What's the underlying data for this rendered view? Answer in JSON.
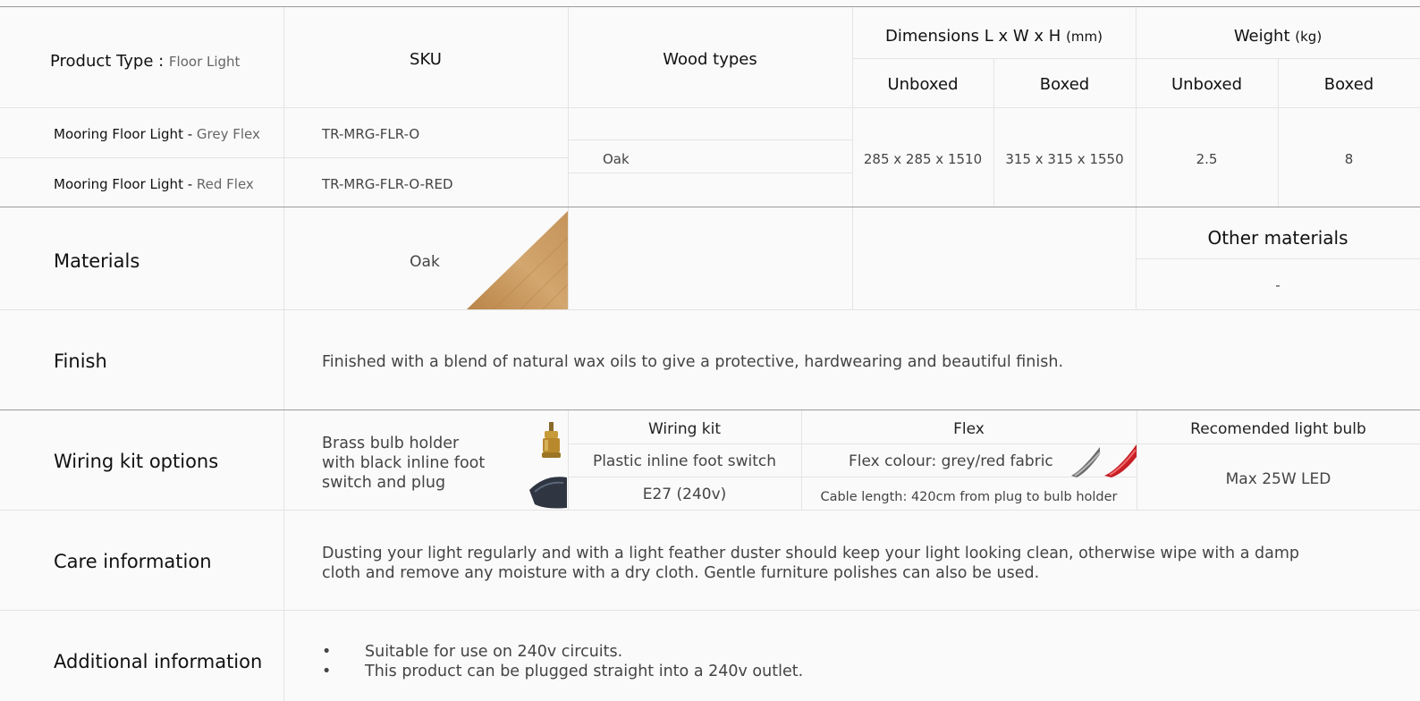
{
  "specs": {
    "product_type_label": "Product Type : ",
    "product_type_value": "Floor Light",
    "sku_header": "SKU",
    "wood_header": "Wood types",
    "dimensions_header": "Dimensions L x W x H",
    "dimensions_unit": "(mm)",
    "weight_header": "Weight",
    "weight_unit": "(kg)",
    "unboxed_label": "Unboxed",
    "boxed_label": "Boxed",
    "rows": [
      {
        "name": "Mooring Floor Light - ",
        "variant": "Grey Flex",
        "sku": "TR-MRG-FLR-O"
      },
      {
        "name": "Mooring Floor Light - ",
        "variant": "Red Flex",
        "sku": "TR-MRG-FLR-O-RED"
      }
    ],
    "wood_value": "Oak",
    "dim_unboxed": "285 x 285 x 1510",
    "dim_boxed": "315 x 315 x 1550",
    "weight_unboxed": "2.5",
    "weight_boxed": "8"
  },
  "materials": {
    "label": "Materials",
    "value": "Oak",
    "other_header": "Other materials",
    "other_value": "-",
    "swatch_color": "#c99a62"
  },
  "finish": {
    "label": "Finish",
    "text": "Finished with a blend of natural wax oils to give a protective, hardwearing and beautiful finish."
  },
  "wiring": {
    "label": "Wiring kit options",
    "desc_line1": "Brass bulb holder",
    "desc_line2": "with black inline foot",
    "desc_line3": "switch and plug",
    "kit_header": "Wiring kit",
    "kit_switch": "Plastic inline foot switch",
    "kit_socket": "E27 (240v)",
    "flex_header": "Flex",
    "flex_colour": "Flex colour: grey/red fabric",
    "flex_length": "Cable length: 420cm from plug to bulb holder",
    "bulb_header": "Recomended light bulb",
    "bulb_value": "Max 25W LED"
  },
  "care": {
    "label": "Care information",
    "line1": "Dusting your light regularly and with a light feather duster should keep your light looking clean, otherwise wipe with a damp",
    "line2": "cloth and remove any moisture with a dry cloth. Gentle furniture polishes can also be used."
  },
  "additional": {
    "label": "Additional information",
    "bullet": "•",
    "items": [
      "Suitable for use on 240v circuits.",
      "This product can be plugged straight into a 240v outlet."
    ]
  }
}
